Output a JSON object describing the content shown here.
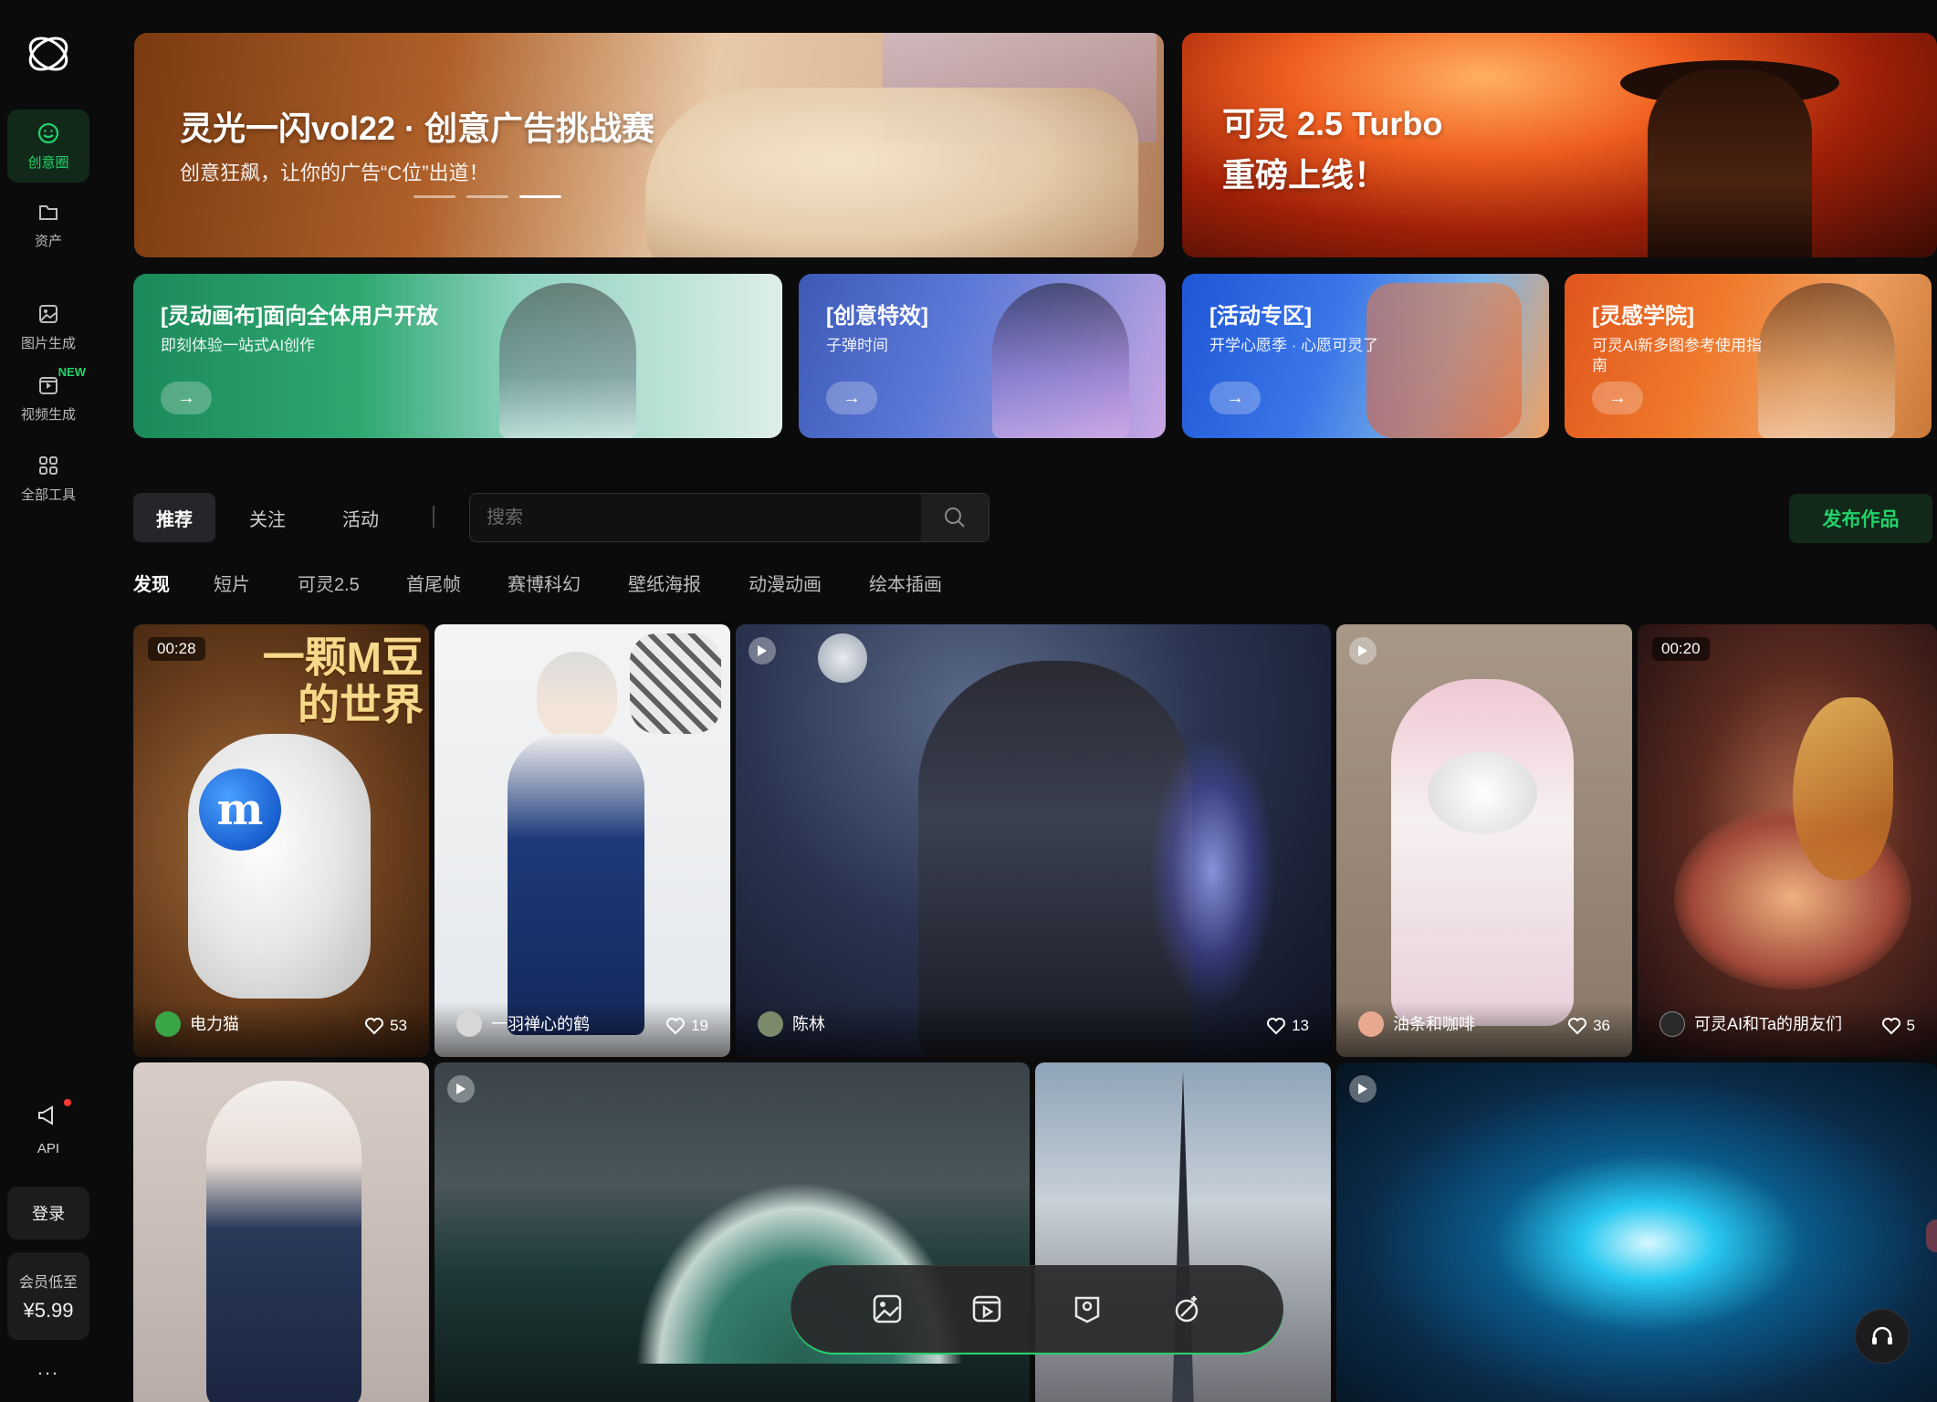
{
  "sidebar": {
    "items": [
      {
        "label": "创意圈",
        "icon": "smile-icon",
        "active": true
      },
      {
        "label": "资产",
        "icon": "folder-icon"
      },
      {
        "label": "图片生成",
        "icon": "image-icon"
      },
      {
        "label": "视频生成",
        "icon": "video-icon",
        "badge": "NEW"
      },
      {
        "label": "全部工具",
        "icon": "grid-icon"
      }
    ],
    "api_label": "API",
    "login_label": "登录",
    "member_line1": "会员低至",
    "member_price": "¥5.99",
    "more_label": "..."
  },
  "banners": {
    "main": {
      "title": "灵光一闪vol22 · 创意广告挑战赛",
      "subtitle": "创意狂飙，让你的广告“C位”出道！"
    },
    "side": {
      "title_line1": "可灵 2.5 Turbo",
      "title_line2": "重磅上线！"
    },
    "cards": [
      {
        "title": "[灵动画布]面向全体用户开放",
        "subtitle": "即刻体验一站式AI创作",
        "arrow": "→"
      },
      {
        "title": "[创意特效]",
        "subtitle": "子弹时间",
        "arrow": "→"
      },
      {
        "title": "[活动专区]",
        "subtitle": "开学心愿季 · 心愿可灵了",
        "arrow": "→"
      },
      {
        "title": "[灵感学院]",
        "subtitle": "可灵AI新多图参考使用指南",
        "arrow": "→"
      }
    ]
  },
  "filters": {
    "tabs": [
      "推荐",
      "关注",
      "活动"
    ],
    "search_placeholder": "搜索",
    "publish_label": "发布作品"
  },
  "categories": [
    "发现",
    "短片",
    "可灵2.5",
    "首尾帧",
    "赛博科幻",
    "壁纸海报",
    "动漫动画",
    "绘本插画"
  ],
  "feed": [
    {
      "duration": "00:28",
      "user": "电力猫",
      "likes": "53",
      "big_text_1": "一颗M豆",
      "big_text_2": "的世界",
      "ball_letter": "m"
    },
    {
      "user": "一羽禅心的鹤",
      "likes": "19"
    },
    {
      "user": "陈林",
      "likes": "13"
    },
    {
      "user": "油条和咖啡",
      "likes": "36"
    },
    {
      "duration": "00:20",
      "user": "可灵AI和Ta的朋友们",
      "likes": "5"
    }
  ],
  "colors": {
    "accent": "#22d36a",
    "background": "#0b0b0c"
  }
}
